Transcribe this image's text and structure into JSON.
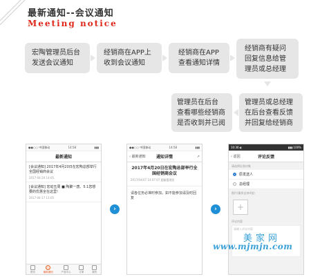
{
  "header": {
    "title_zh": "最新通知--会议通知",
    "title_en": "Meeting notice"
  },
  "flow": {
    "step1": [
      "宏陶管理员后台",
      "发送会议通知"
    ],
    "step2": [
      "经销商在APP上",
      "收到会议通知"
    ],
    "step3": [
      "经销商在APP",
      "查看通知详情"
    ],
    "step4": [
      "经销商有疑问",
      "回复信息给管",
      "理员或总经理"
    ],
    "step5": [
      "管理员在后台",
      "查看哪些经销商",
      "是否收到并已阅"
    ],
    "step6": [
      "管理员或总经理",
      "在后台查看反馈",
      "并回复给经销商"
    ]
  },
  "phone1": {
    "status_left": "●●○○ 中国移动",
    "status_time": "14:58",
    "status_right": "▮▮▮",
    "nav_title": "最新通知",
    "notices": [
      {
        "title": "[会议通知] 2017年4月20日在宏陶总部举行全国经销商会议",
        "time": "2017-04-20 14:05"
      },
      {
        "title": "[会议通知] 宏动五周 ■ 陶聚一唐、5.1您想要的优惠全在这里!",
        "time": "2017-04-17 11:05"
      }
    ],
    "tabs": [
      "首页",
      "最新通知",
      "产品中心",
      "订单",
      "我的"
    ]
  },
  "phone2": {
    "status_left": "●●○○ 中国移动",
    "status_time": "14:58",
    "status_right": "▮▮▮",
    "nav_back": "‹ 最新通知",
    "nav_title": "通知详情",
    "nav_action": "↗",
    "title": "2017年4月20日在宏陶总部举行全国经销商会议",
    "meta": "2017/04/07 14:07:07   超级管理员",
    "body": "请各位务必准时参加，如不能参加请及时回复"
  },
  "phone3": {
    "status_left": "10:36 ◐",
    "status_time": "",
    "status_right": "▮▮▮ 100%",
    "nav_back": "‹ 返回",
    "nav_title": "评论反馈",
    "section_recipient": "请选择反馈对象",
    "option_1": "原发送人",
    "option_2": "总经理",
    "section_images": "图片(最多支持4张)",
    "upload_plus": "+",
    "section_comment": "评论内容",
    "comment_placeholder": "请输入评论内容"
  },
  "arrows": {
    "next_glyph": "›"
  },
  "watermark": {
    "name": "美家网",
    "url": "www.mjmjn.com"
  },
  "colors": {
    "accent_red": "#e0281a",
    "step_bg": "#e6e6e6",
    "arrow_blue": "#1f8fd6",
    "watermark_blue": "#3aa0d8",
    "tab_active": "#e8632a"
  }
}
